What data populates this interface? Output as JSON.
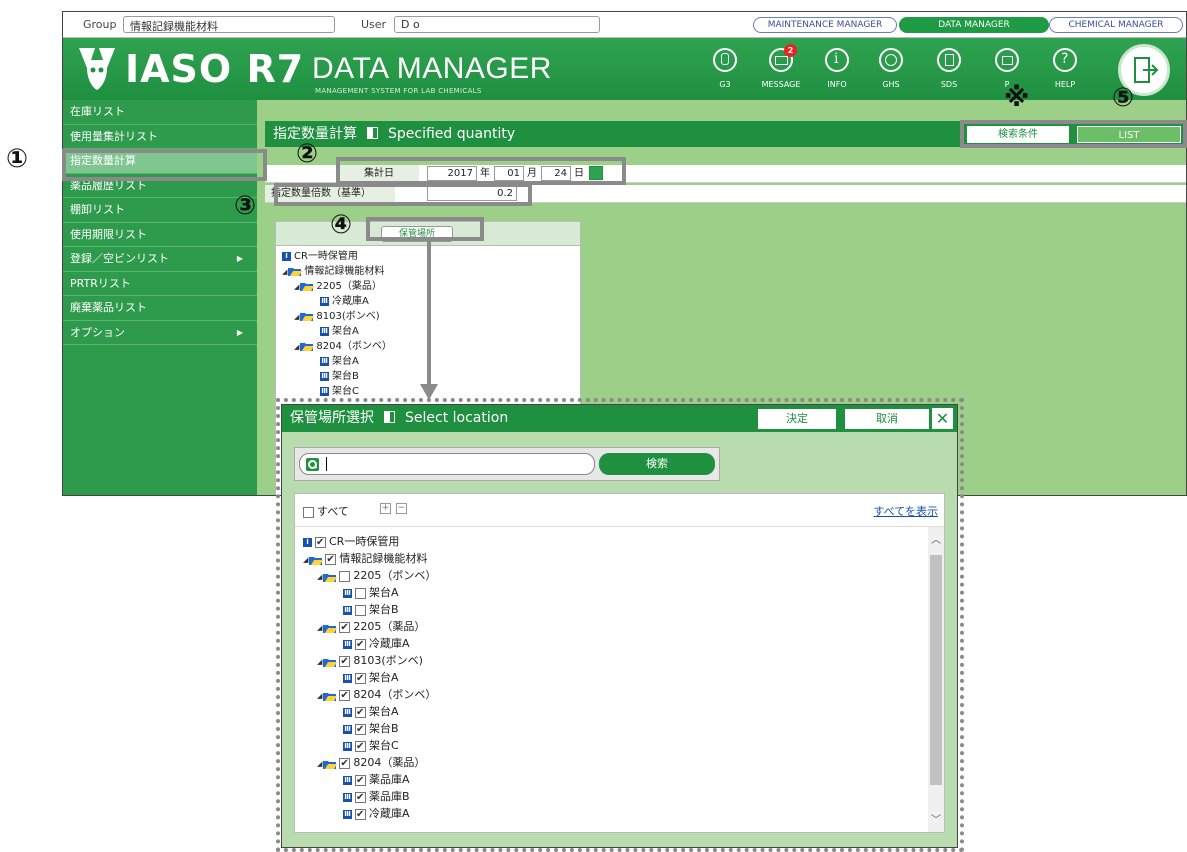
{
  "topbar": {
    "group_label": "Group",
    "group_value": "情報記録機能材料",
    "user_label": "User",
    "user_value": "D o",
    "tabs": [
      "MAINTENANCE MANAGER",
      "DATA MANAGER",
      "CHEMICAL MANAGER"
    ],
    "active_tab": "DATA MANAGER"
  },
  "header": {
    "brand": "IASO R7",
    "title": "DATA MANAGER",
    "subtitle": "MANAGEMENT SYSTEM FOR LAB CHEMICALS",
    "icons": [
      {
        "label": "G3",
        "icon": "g3-icon"
      },
      {
        "label": "MESSAGE",
        "icon": "message-icon",
        "badge": "2"
      },
      {
        "label": "INFO",
        "icon": "info-icon"
      },
      {
        "label": "GHS",
        "icon": "globe-icon"
      },
      {
        "label": "SDS",
        "icon": "sds-icon"
      },
      {
        "label": "P",
        "icon": "print-icon"
      },
      {
        "label": "HELP",
        "icon": "help-icon"
      }
    ],
    "accent_color": "#1f8f40"
  },
  "sidebar": {
    "items": [
      {
        "label": "在庫リスト"
      },
      {
        "label": "使用量集計リスト"
      },
      {
        "label": "指定数量計算",
        "active": true
      },
      {
        "label": "薬品履歴リスト"
      },
      {
        "label": "棚卸リスト"
      },
      {
        "label": "使用期限リスト"
      },
      {
        "label": "登録／空ビンリスト",
        "submenu": true
      },
      {
        "label": "PRTRリスト"
      },
      {
        "label": "廃棄薬品リスト"
      },
      {
        "label": "オプション",
        "submenu": true
      }
    ]
  },
  "content": {
    "title_ja": "指定数量計算",
    "title_en": "Specified quantity",
    "search_condition": "検索条件",
    "list_button": "LIST",
    "date_label": "集計日",
    "date_year": "2017",
    "year_unit": "年",
    "date_month": "01",
    "month_unit": "月",
    "date_day": "24",
    "day_unit": "日",
    "multiplier_label": "指定数量倍数（基準）",
    "multiplier_value": "0.2",
    "location_button": "保管場所",
    "tree": [
      {
        "label": "CR一時保管用",
        "level": 0,
        "icon": "I"
      },
      {
        "label": "情報記録機能材料",
        "level": 0,
        "icon": "folder"
      },
      {
        "label": "2205（薬品）",
        "level": 1,
        "icon": "folder"
      },
      {
        "label": "冷蔵庫A",
        "level": 2,
        "icon": "III"
      },
      {
        "label": "8103(ボンベ)",
        "level": 1,
        "icon": "folder"
      },
      {
        "label": "架台A",
        "level": 2,
        "icon": "III"
      },
      {
        "label": "8204（ボンベ）",
        "level": 1,
        "icon": "folder"
      },
      {
        "label": "架台A",
        "level": 2,
        "icon": "III"
      },
      {
        "label": "架台B",
        "level": 2,
        "icon": "III"
      },
      {
        "label": "架台C",
        "level": 2,
        "icon": "III"
      }
    ]
  },
  "annotations": {
    "n1": "①",
    "n2": "②",
    "n3": "③",
    "n4": "④",
    "n5": "⑤",
    "note": "※"
  },
  "dialog": {
    "title_ja": "保管場所選択",
    "title_en": "Select location",
    "ok": "決定",
    "cancel": "取消",
    "close": "✕",
    "search_placeholder": "",
    "search_button": "検索",
    "select_all": "すべて",
    "show_all": "すべてを表示",
    "items": [
      {
        "label": "CR一時保管用",
        "level": 0,
        "icon": "I",
        "checked": true
      },
      {
        "label": "情報記録機能材料",
        "level": 0,
        "icon": "folder",
        "checked": true
      },
      {
        "label": "2205（ボンベ）",
        "level": 1,
        "icon": "folder",
        "checked": false
      },
      {
        "label": "架台A",
        "level": 2,
        "icon": "III",
        "checked": false
      },
      {
        "label": "架台B",
        "level": 2,
        "icon": "III",
        "checked": false
      },
      {
        "label": "2205（薬品）",
        "level": 1,
        "icon": "folder",
        "checked": true
      },
      {
        "label": "冷蔵庫A",
        "level": 2,
        "icon": "III",
        "checked": true
      },
      {
        "label": "8103(ボンベ)",
        "level": 1,
        "icon": "folder",
        "checked": true
      },
      {
        "label": "架台A",
        "level": 2,
        "icon": "III",
        "checked": true
      },
      {
        "label": "8204（ボンベ）",
        "level": 1,
        "icon": "folder",
        "checked": true
      },
      {
        "label": "架台A",
        "level": 2,
        "icon": "III",
        "checked": true
      },
      {
        "label": "架台B",
        "level": 2,
        "icon": "III",
        "checked": true
      },
      {
        "label": "架台C",
        "level": 2,
        "icon": "III",
        "checked": true
      },
      {
        "label": "8204（薬品）",
        "level": 1,
        "icon": "folder",
        "checked": true
      },
      {
        "label": "薬品庫A",
        "level": 2,
        "icon": "III",
        "checked": true
      },
      {
        "label": "薬品庫B",
        "level": 2,
        "icon": "III",
        "checked": true
      },
      {
        "label": "冷蔵庫A",
        "level": 2,
        "icon": "III",
        "checked": true
      }
    ]
  }
}
